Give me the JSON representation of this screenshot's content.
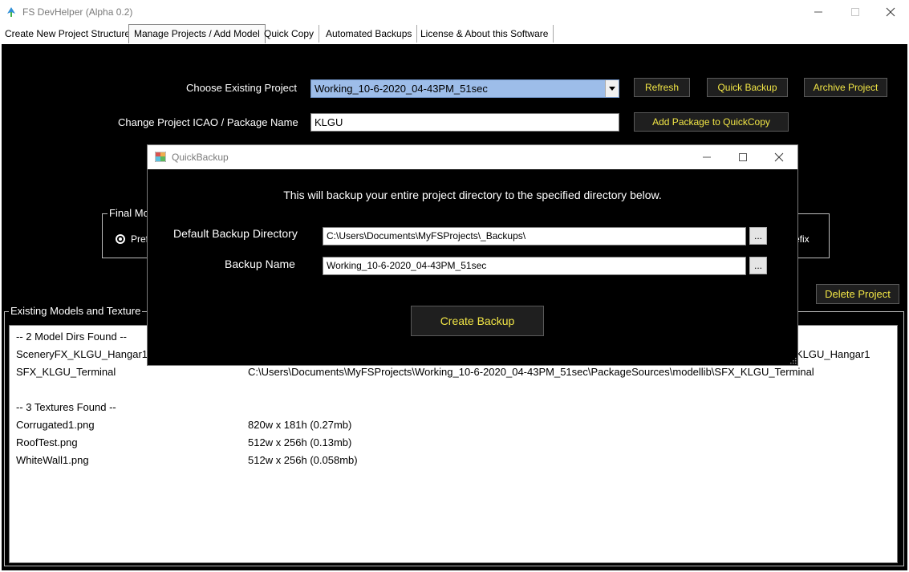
{
  "window": {
    "title": "FS DevHelper (Alpha 0.2)"
  },
  "tabs": [
    {
      "label": "Create New Project Structure"
    },
    {
      "label": "Manage Projects / Add Model"
    },
    {
      "label": "Quick Copy"
    },
    {
      "label": "Automated Backups"
    },
    {
      "label": "License & About this Software"
    }
  ],
  "manage": {
    "choose_label": "Choose Existing Project",
    "choose_value": "Working_10-6-2020_04-43PM_51sec",
    "change_label": "Change Project ICAO / Package Name",
    "change_value": "KLGU",
    "refresh_button": "Refresh",
    "quick_backup_button": "Quick Backup",
    "archive_button": "Archive Project",
    "add_package_button": "Add Package to QuickCopy",
    "final_model_group_partial": "Final Mo",
    "radio_prefix_partial": "Pref",
    "radio_right_partial": "efix",
    "delete_button": "Delete Project",
    "existing_group_partial": "Existing Models and Texture"
  },
  "list": {
    "rows": [
      {
        "name": "-- 2 Model Dirs Found --",
        "detail": ""
      },
      {
        "name": "SceneryFX_KLGU_Hangar1",
        "detail": "KLGU_Hangar1"
      },
      {
        "name": "SFX_KLGU_Terminal",
        "detail": "C:\\Users\\Documents\\MyFSProjects\\Working_10-6-2020_04-43PM_51sec\\PackageSources\\modellib\\SFX_KLGU_Terminal"
      },
      {
        "name": "",
        "detail": ""
      },
      {
        "name": "-- 3 Textures Found --",
        "detail": ""
      },
      {
        "name": "Corrugated1.png",
        "detail": "820w x 181h (0.27mb)"
      },
      {
        "name": "RoofTest.png",
        "detail": "512w x 256h (0.13mb)"
      },
      {
        "name": "WhiteWall1.png",
        "detail": "512w x 256h (0.058mb)"
      }
    ]
  },
  "dialog": {
    "title": "QuickBackup",
    "message": "This will backup your entire project directory to the specified directory below.",
    "dir_label": "Default Backup Directory",
    "dir_value": "C:\\Users\\Documents\\MyFSProjects\\_Backups\\",
    "name_label": "Backup Name",
    "name_value": "Working_10-6-2020_04-43PM_51sec",
    "browse_label": "...",
    "create_button": "Create Backup"
  },
  "colors": {
    "accent_text": "#f2e646",
    "panel_bg": "#000000",
    "selection": "#9dbde9"
  }
}
